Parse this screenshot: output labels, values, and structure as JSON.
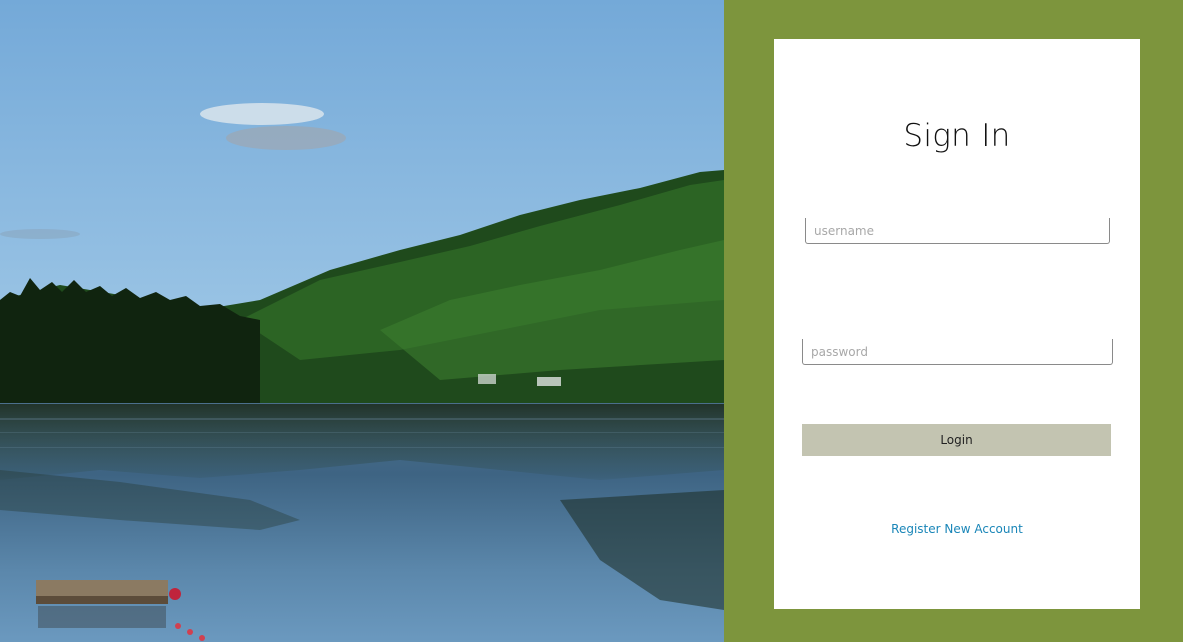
{
  "signin": {
    "title": "Sign In",
    "username_placeholder": "username",
    "password_placeholder": "password",
    "login_label": "Login",
    "register_label": "Register New Account"
  },
  "colors": {
    "panel_background": "#7d953d",
    "card_background": "#ffffff",
    "login_button": "#c3c4b1",
    "link": "#1a86b8"
  }
}
